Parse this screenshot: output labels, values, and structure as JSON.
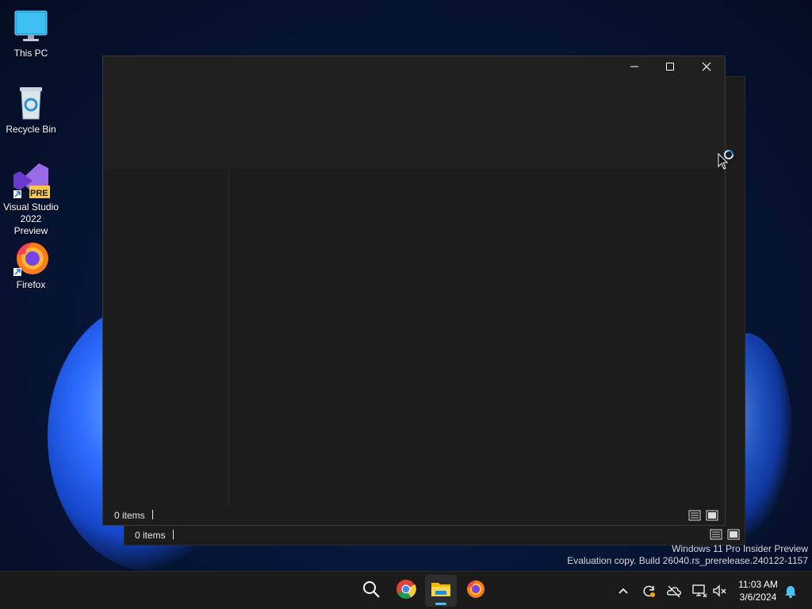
{
  "desktop": {
    "icons": [
      {
        "label": "This PC"
      },
      {
        "label": "Recycle Bin"
      },
      {
        "label": "Visual Studio 2022 Preview",
        "badge": "PRE"
      },
      {
        "label": "Firefox"
      }
    ]
  },
  "background_window": {
    "status": {
      "items_count": "0 items"
    }
  },
  "window": {
    "controls": {
      "minimize": "minimize",
      "maximize": "maximize",
      "close": "close"
    },
    "status": {
      "items_count": "0 items"
    }
  },
  "watermark": {
    "line1": "Windows 11 Pro Insider Preview",
    "line2": "Evaluation copy. Build 26040.rs_prerelease.240122-1157"
  },
  "taskbar": {
    "apps": [
      "search-icon",
      "chrome-icon",
      "file-explorer-icon",
      "firefox-icon"
    ],
    "tray": [
      "chevron-up-icon",
      "sync-icon",
      "onedrive-icon",
      "network-icon",
      "volume-muted-icon"
    ],
    "clock": {
      "time": "11:03 AM",
      "date": "3/6/2024"
    }
  },
  "colors": {
    "accent": "#4cc2ff",
    "window_bg": "#1c1c1c",
    "titlebar_bg": "#202020"
  }
}
